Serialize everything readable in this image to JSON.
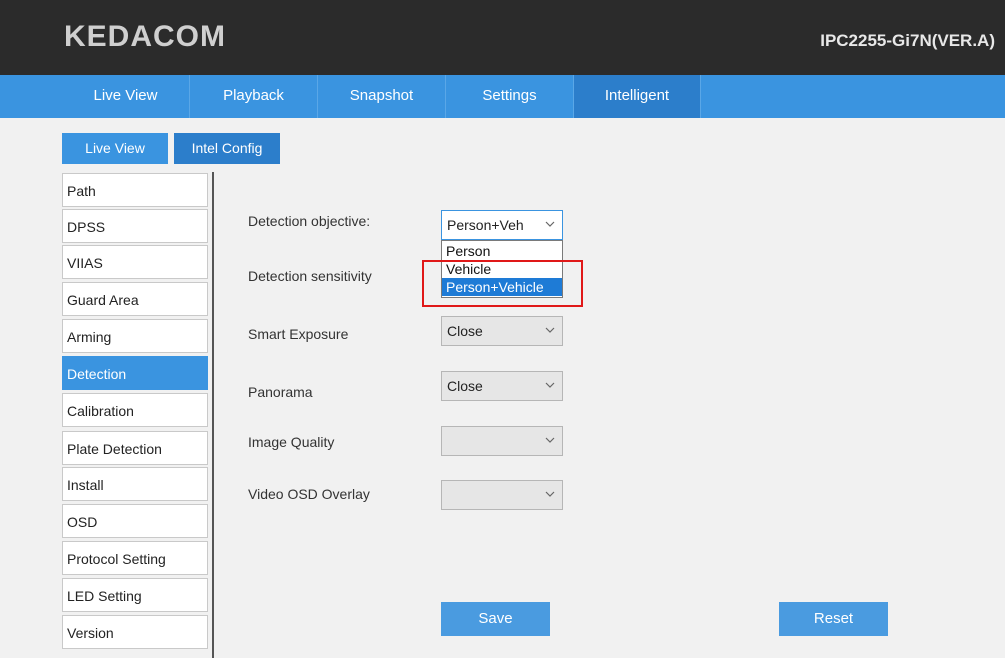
{
  "header": {
    "brand": "KEDACOM",
    "model": "IPC2255-Gi7N(VER.A)"
  },
  "nav": {
    "tabs": [
      "Live View",
      "Playback",
      "Snapshot",
      "Settings",
      "Intelligent"
    ]
  },
  "subtabs": [
    "Live View",
    "Intel Config"
  ],
  "sidebar": {
    "items": [
      "Path",
      "DPSS",
      "VIIAS",
      "Guard Area",
      "Arming",
      "Detection",
      "Calibration",
      "Plate Detection",
      "Install",
      "OSD",
      "Protocol Setting",
      "LED Setting",
      "Version"
    ],
    "active": "Detection"
  },
  "form": {
    "detection_objective": {
      "label": "Detection objective:",
      "value": "Person+Veh",
      "options": [
        "Person",
        "Vehicle",
        "Person+Vehicle"
      ],
      "selected": "Person+Vehicle"
    },
    "detection_sensitivity": {
      "label": "Detection sensitivity"
    },
    "smart_exposure": {
      "label": "Smart Exposure",
      "value": "Close"
    },
    "panorama": {
      "label": "Panorama",
      "value": "Close"
    },
    "image_quality": {
      "label": "Image Quality",
      "value": ""
    },
    "video_osd_overlay": {
      "label": "Video OSD Overlay",
      "value": ""
    }
  },
  "buttons": {
    "save": "Save",
    "reset": "Reset"
  },
  "colors": {
    "accent": "#3a94e0",
    "active_tab": "#2c7ecb",
    "highlight": "#e01818",
    "header_bg": "#2b2b2b"
  }
}
